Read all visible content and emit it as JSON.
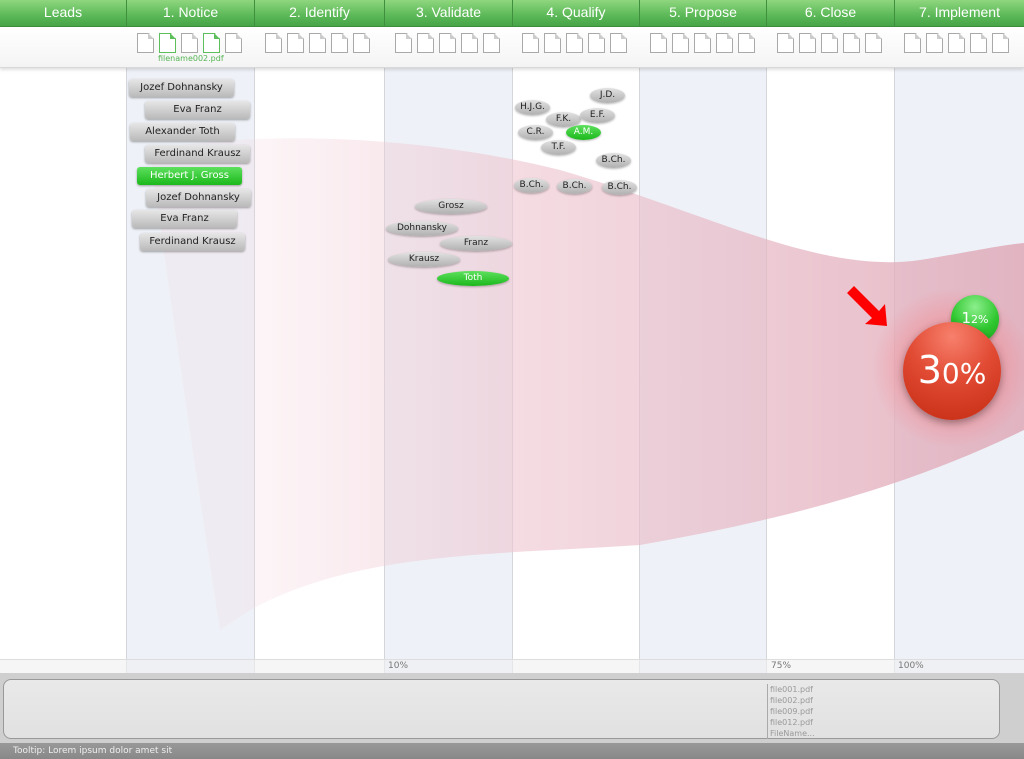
{
  "columns": [
    {
      "label": "Leads"
    },
    {
      "label": "1. Notice"
    },
    {
      "label": "2. Identify"
    },
    {
      "label": "3. Validate"
    },
    {
      "label": "4. Qualify"
    },
    {
      "label": "5. Propose"
    },
    {
      "label": "6. Close"
    },
    {
      "label": "7. Implement"
    }
  ],
  "notice_file_name": "filename002.pdf",
  "notice_people": [
    {
      "name": "Jozef Dohnansky",
      "selected": false
    },
    {
      "name": "Eva Franz",
      "selected": false
    },
    {
      "name": "Alexander Toth",
      "selected": false
    },
    {
      "name": "Ferdinand Krausz",
      "selected": false
    },
    {
      "name": "Herbert J. Gross",
      "selected": true
    },
    {
      "name": "Jozef Dohnansky",
      "selected": false
    },
    {
      "name": "Eva Franz",
      "selected": false
    },
    {
      "name": "Ferdinand Krausz",
      "selected": false
    }
  ],
  "validate_people": [
    {
      "name": "Grosz",
      "selected": false
    },
    {
      "name": "Dohnansky",
      "selected": false
    },
    {
      "name": "Franz",
      "selected": false
    },
    {
      "name": "Krausz",
      "selected": false
    },
    {
      "name": "Toth",
      "selected": true
    }
  ],
  "qualify_people": [
    {
      "name": "J.D.",
      "selected": false
    },
    {
      "name": "H.J.G.",
      "selected": false
    },
    {
      "name": "F.K.",
      "selected": false
    },
    {
      "name": "E.F.",
      "selected": false
    },
    {
      "name": "C.R.",
      "selected": false
    },
    {
      "name": "A.M.",
      "selected": true
    },
    {
      "name": "T.F.",
      "selected": false
    },
    {
      "name": "B.Ch.",
      "selected": false
    },
    {
      "name": "B.Ch.",
      "selected": false
    },
    {
      "name": "B.Ch.",
      "selected": false
    },
    {
      "name": "B.Ch.",
      "selected": false
    }
  ],
  "progress_labels": {
    "validate": "10%",
    "close": "75%",
    "implement": "100%"
  },
  "indicators": {
    "main": {
      "big": "3",
      "small": "0%",
      "color": "#d63a22"
    },
    "secondary": {
      "big": "1",
      "small": "2%",
      "color": "#2fc72f"
    }
  },
  "file_list": [
    "file001.pdf",
    "file002.pdf",
    "file009.pdf",
    "file012.pdf",
    "FileName..."
  ],
  "status_text": "Tooltip: Lorem ipsum dolor amet sit",
  "colors": {
    "header_green": "#5fbb5a",
    "selected_green": "#1bb81b",
    "band_pink": "#e8b8c4",
    "arrow_red": "#ff0000"
  }
}
